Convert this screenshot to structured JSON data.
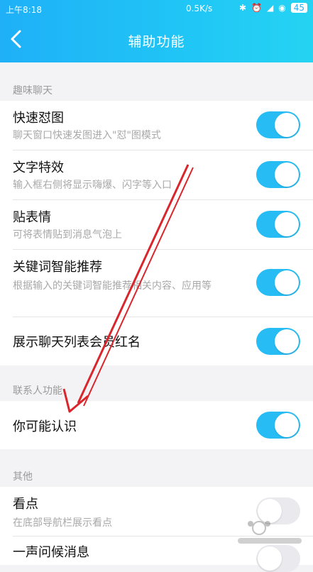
{
  "status": {
    "time": "上午8:18",
    "network": "0.5K/s",
    "battery": "45"
  },
  "header": {
    "title": "辅助功能"
  },
  "sections": [
    {
      "label": "趣味聊天"
    },
    {
      "label": "联系人功能"
    },
    {
      "label": "其他"
    }
  ],
  "items": {
    "quick": {
      "title": "快速怼图",
      "sub": "聊天窗口快速发图进入\"怼\"图模式",
      "on": true
    },
    "text_effect": {
      "title": "文字特效",
      "sub": "输入框右侧将显示嗨爆、闪字等入口",
      "on": true
    },
    "sticker": {
      "title": "贴表情",
      "sub": "可将表情贴到消息气泡上",
      "on": true
    },
    "keyword": {
      "title": "关键词智能推荐",
      "sub": "根据输入的关键词智能推荐相关内容、应用等",
      "on": true
    },
    "vip": {
      "title": "展示聊天列表会员红名",
      "on": true
    },
    "maybe_know": {
      "title": "你可能认识",
      "on": true
    },
    "kandian": {
      "title": "看点",
      "sub": "在底部导航栏展示看点",
      "on": false
    },
    "greeting": {
      "title": "一声问候消息",
      "on": false
    }
  },
  "colors": {
    "accent": "#27bdf4",
    "annotation_arrow": "#d9262c"
  }
}
